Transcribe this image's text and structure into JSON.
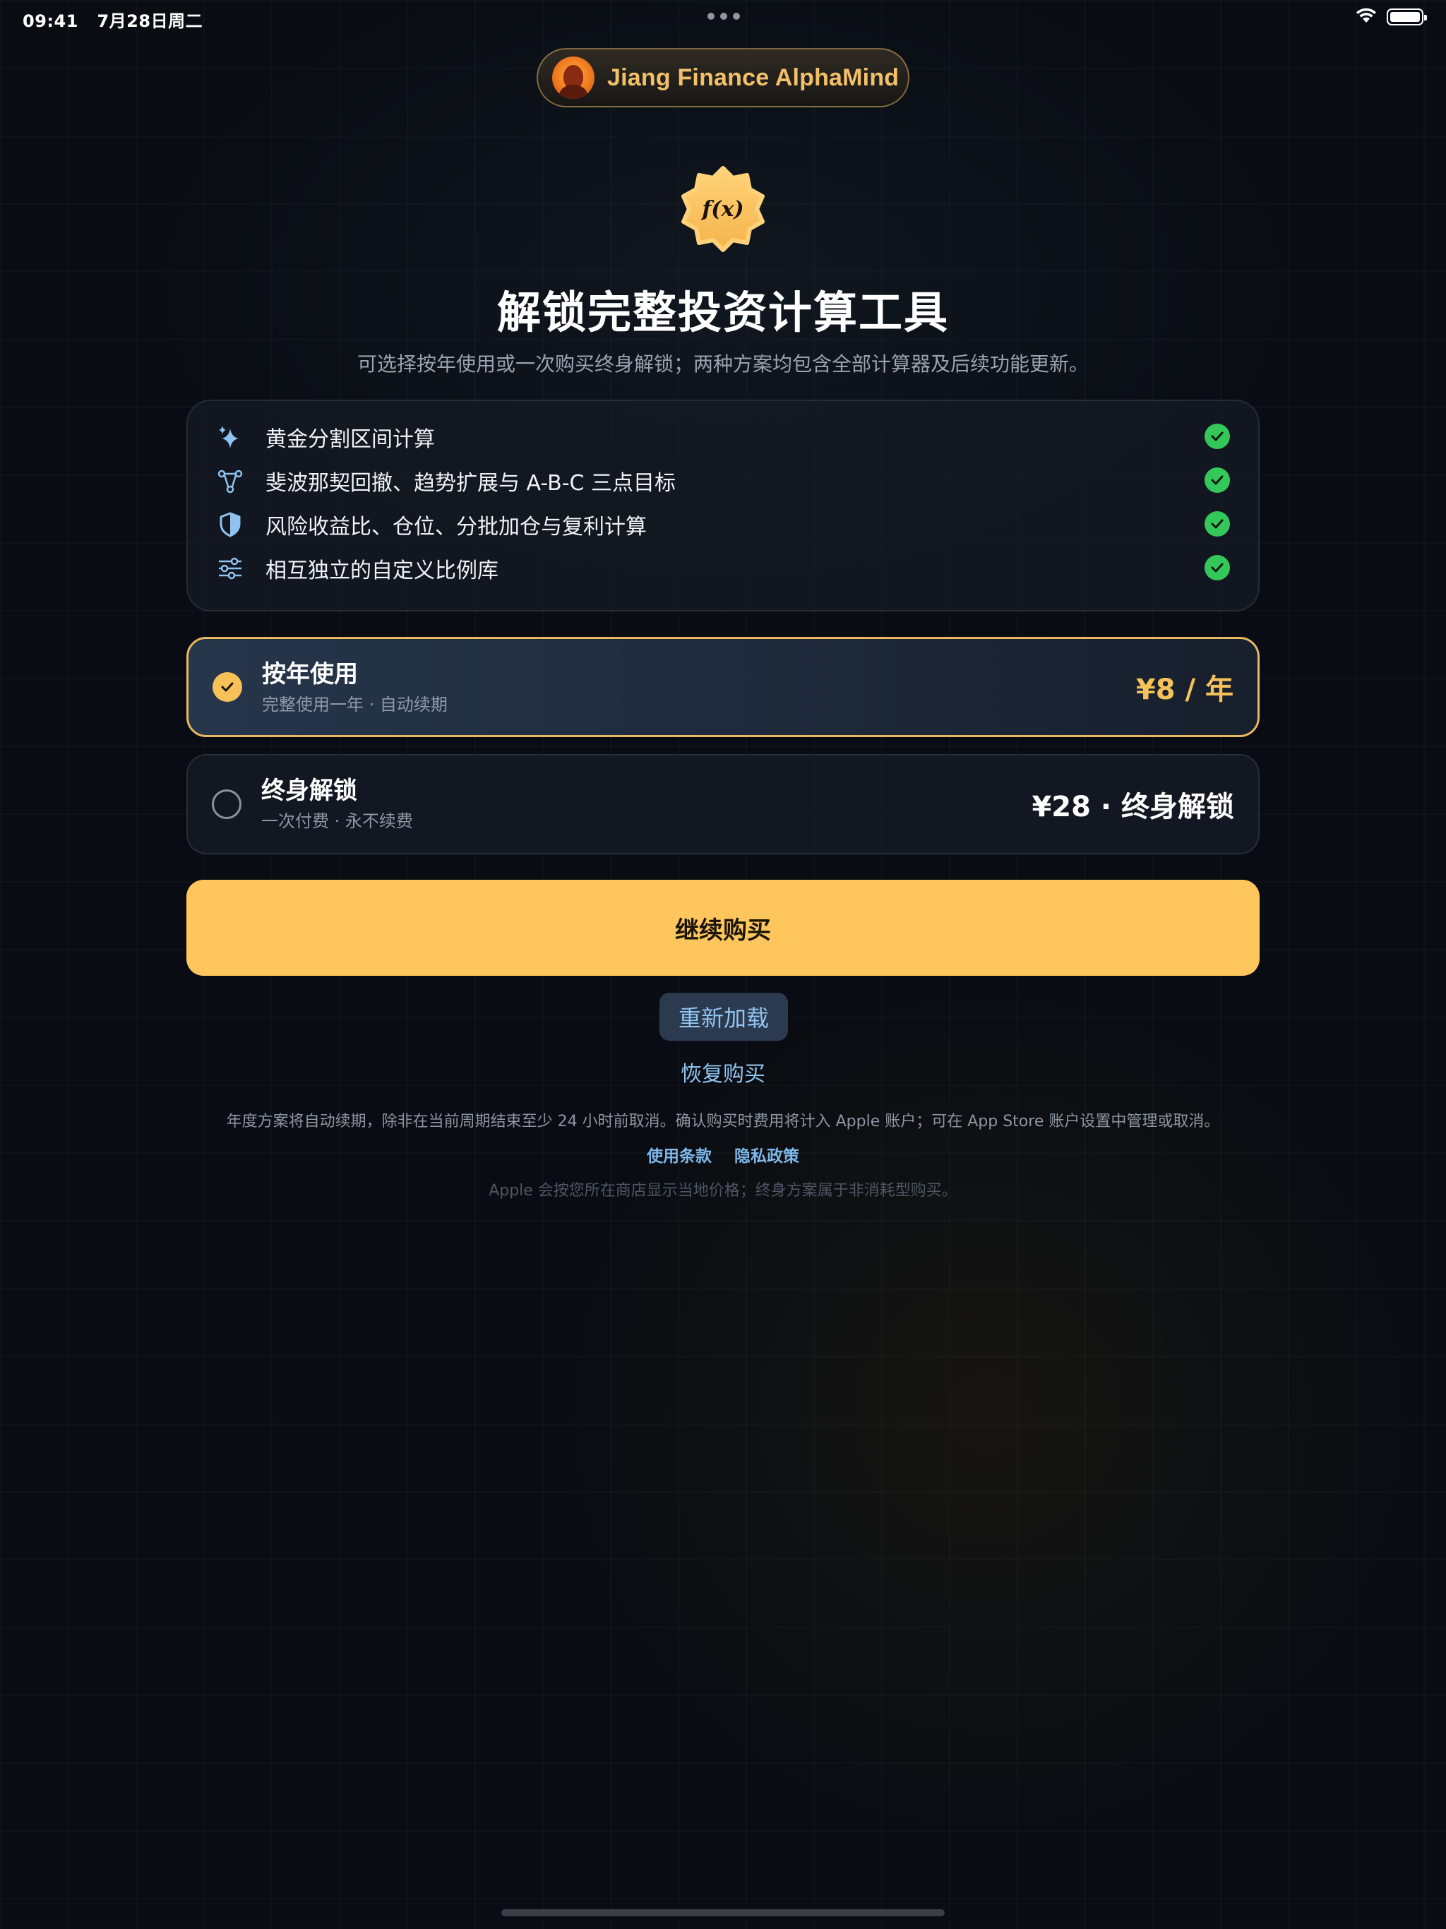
{
  "status_bar": {
    "time": "09:41",
    "date": "7月28日周二",
    "icons": [
      "wifi-icon",
      "battery-icon"
    ]
  },
  "brand": {
    "name": "Jiang Finance AlphaMind",
    "color": "#f2c069"
  },
  "hero": {
    "badge_text": "f(x)",
    "title": "解锁完整投资计算工具",
    "subtitle": "可选择按年使用或一次购买终身解锁；两种方案均包含全部计算器及后续功能更新。"
  },
  "features": [
    {
      "icon": "sparkles-icon",
      "label": "黄金分割区间计算"
    },
    {
      "icon": "network-nodes-icon",
      "label": "斐波那契回撤、趋势扩展与 A-B-C 三点目标"
    },
    {
      "icon": "shield-icon",
      "label": "风险收益比、仓位、分批加仓与复利计算"
    },
    {
      "icon": "sliders-icon",
      "label": "相互独立的自定义比例库"
    }
  ],
  "plans": {
    "yearly": {
      "name": "按年使用",
      "desc": "完整使用一年 · 自动续期",
      "price": "¥8 / 年",
      "selected": true
    },
    "lifetime": {
      "name": "终身解锁",
      "desc": "一次付费 · 永不续费",
      "price": "¥28 · 终身解锁",
      "selected": false
    }
  },
  "actions": {
    "continue_label": "继续购买",
    "reload_label": "重新加载",
    "restore_label": "恢复购买"
  },
  "legal": {
    "text": "年度方案将自动续期，除非在当前周期结束至少 24 小时前取消。确认购买时费用将计入 Apple 账户；可在 App Store 账户设置中管理或取消。",
    "terms_label": "使用条款",
    "privacy_label": "隐私政策",
    "note": "Apple 会按您所在商店显示当地价格；终身方案属于非消耗型购买。"
  },
  "colors": {
    "accent": "#ffc65e",
    "link": "#8fc4f0",
    "check": "#34c759"
  }
}
